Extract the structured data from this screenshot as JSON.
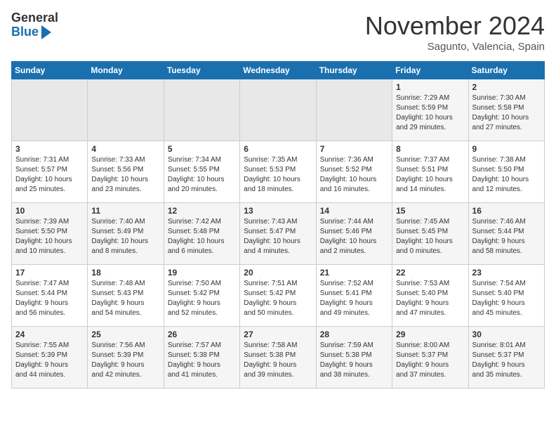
{
  "header": {
    "logo_general": "General",
    "logo_blue": "Blue",
    "month": "November 2024",
    "location": "Sagunto, Valencia, Spain"
  },
  "weekdays": [
    "Sunday",
    "Monday",
    "Tuesday",
    "Wednesday",
    "Thursday",
    "Friday",
    "Saturday"
  ],
  "weeks": [
    [
      {
        "day": "",
        "info": ""
      },
      {
        "day": "",
        "info": ""
      },
      {
        "day": "",
        "info": ""
      },
      {
        "day": "",
        "info": ""
      },
      {
        "day": "",
        "info": ""
      },
      {
        "day": "1",
        "info": "Sunrise: 7:29 AM\nSunset: 5:59 PM\nDaylight: 10 hours\nand 29 minutes."
      },
      {
        "day": "2",
        "info": "Sunrise: 7:30 AM\nSunset: 5:58 PM\nDaylight: 10 hours\nand 27 minutes."
      }
    ],
    [
      {
        "day": "3",
        "info": "Sunrise: 7:31 AM\nSunset: 5:57 PM\nDaylight: 10 hours\nand 25 minutes."
      },
      {
        "day": "4",
        "info": "Sunrise: 7:33 AM\nSunset: 5:56 PM\nDaylight: 10 hours\nand 23 minutes."
      },
      {
        "day": "5",
        "info": "Sunrise: 7:34 AM\nSunset: 5:55 PM\nDaylight: 10 hours\nand 20 minutes."
      },
      {
        "day": "6",
        "info": "Sunrise: 7:35 AM\nSunset: 5:53 PM\nDaylight: 10 hours\nand 18 minutes."
      },
      {
        "day": "7",
        "info": "Sunrise: 7:36 AM\nSunset: 5:52 PM\nDaylight: 10 hours\nand 16 minutes."
      },
      {
        "day": "8",
        "info": "Sunrise: 7:37 AM\nSunset: 5:51 PM\nDaylight: 10 hours\nand 14 minutes."
      },
      {
        "day": "9",
        "info": "Sunrise: 7:38 AM\nSunset: 5:50 PM\nDaylight: 10 hours\nand 12 minutes."
      }
    ],
    [
      {
        "day": "10",
        "info": "Sunrise: 7:39 AM\nSunset: 5:50 PM\nDaylight: 10 hours\nand 10 minutes."
      },
      {
        "day": "11",
        "info": "Sunrise: 7:40 AM\nSunset: 5:49 PM\nDaylight: 10 hours\nand 8 minutes."
      },
      {
        "day": "12",
        "info": "Sunrise: 7:42 AM\nSunset: 5:48 PM\nDaylight: 10 hours\nand 6 minutes."
      },
      {
        "day": "13",
        "info": "Sunrise: 7:43 AM\nSunset: 5:47 PM\nDaylight: 10 hours\nand 4 minutes."
      },
      {
        "day": "14",
        "info": "Sunrise: 7:44 AM\nSunset: 5:46 PM\nDaylight: 10 hours\nand 2 minutes."
      },
      {
        "day": "15",
        "info": "Sunrise: 7:45 AM\nSunset: 5:45 PM\nDaylight: 10 hours\nand 0 minutes."
      },
      {
        "day": "16",
        "info": "Sunrise: 7:46 AM\nSunset: 5:44 PM\nDaylight: 9 hours\nand 58 minutes."
      }
    ],
    [
      {
        "day": "17",
        "info": "Sunrise: 7:47 AM\nSunset: 5:44 PM\nDaylight: 9 hours\nand 56 minutes."
      },
      {
        "day": "18",
        "info": "Sunrise: 7:48 AM\nSunset: 5:43 PM\nDaylight: 9 hours\nand 54 minutes."
      },
      {
        "day": "19",
        "info": "Sunrise: 7:50 AM\nSunset: 5:42 PM\nDaylight: 9 hours\nand 52 minutes."
      },
      {
        "day": "20",
        "info": "Sunrise: 7:51 AM\nSunset: 5:42 PM\nDaylight: 9 hours\nand 50 minutes."
      },
      {
        "day": "21",
        "info": "Sunrise: 7:52 AM\nSunset: 5:41 PM\nDaylight: 9 hours\nand 49 minutes."
      },
      {
        "day": "22",
        "info": "Sunrise: 7:53 AM\nSunset: 5:40 PM\nDaylight: 9 hours\nand 47 minutes."
      },
      {
        "day": "23",
        "info": "Sunrise: 7:54 AM\nSunset: 5:40 PM\nDaylight: 9 hours\nand 45 minutes."
      }
    ],
    [
      {
        "day": "24",
        "info": "Sunrise: 7:55 AM\nSunset: 5:39 PM\nDaylight: 9 hours\nand 44 minutes."
      },
      {
        "day": "25",
        "info": "Sunrise: 7:56 AM\nSunset: 5:39 PM\nDaylight: 9 hours\nand 42 minutes."
      },
      {
        "day": "26",
        "info": "Sunrise: 7:57 AM\nSunset: 5:38 PM\nDaylight: 9 hours\nand 41 minutes."
      },
      {
        "day": "27",
        "info": "Sunrise: 7:58 AM\nSunset: 5:38 PM\nDaylight: 9 hours\nand 39 minutes."
      },
      {
        "day": "28",
        "info": "Sunrise: 7:59 AM\nSunset: 5:38 PM\nDaylight: 9 hours\nand 38 minutes."
      },
      {
        "day": "29",
        "info": "Sunrise: 8:00 AM\nSunset: 5:37 PM\nDaylight: 9 hours\nand 37 minutes."
      },
      {
        "day": "30",
        "info": "Sunrise: 8:01 AM\nSunset: 5:37 PM\nDaylight: 9 hours\nand 35 minutes."
      }
    ]
  ]
}
